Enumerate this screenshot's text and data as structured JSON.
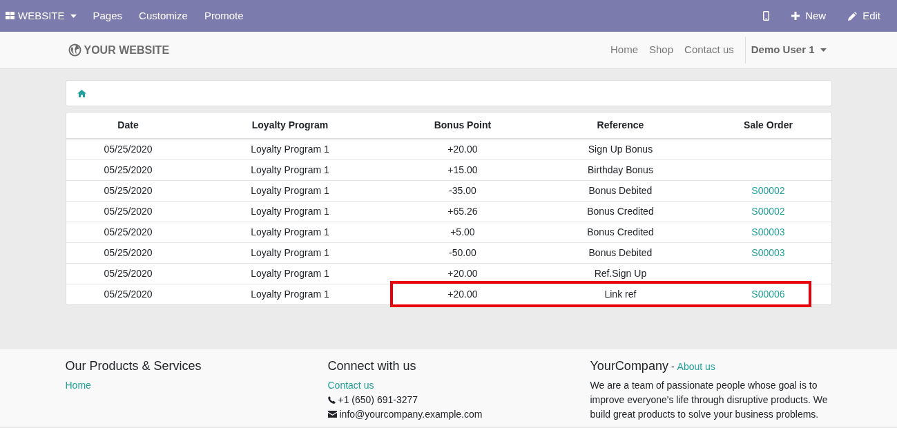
{
  "topbar": {
    "menu": "WEBSITE",
    "items": [
      "Pages",
      "Customize",
      "Promote"
    ],
    "actions": [
      {
        "kind": "mobile"
      },
      {
        "kind": "new",
        "label": "New"
      },
      {
        "kind": "edit",
        "label": "Edit"
      }
    ]
  },
  "header": {
    "logo": "YOUR WEBSITE",
    "nav": [
      {
        "label": "Home"
      },
      {
        "label": "Shop"
      },
      {
        "label": "Contact us"
      }
    ],
    "user": "Demo User 1"
  },
  "table": {
    "columns": [
      "Date",
      "Loyalty Program",
      "Bonus Point",
      "Reference",
      "Sale Order"
    ],
    "rows": [
      {
        "cells": [
          "05/25/2020",
          "Loyalty Program 1",
          "+20.00",
          "Sign Up Bonus",
          ""
        ],
        "highlighted": false
      },
      {
        "cells": [
          "05/25/2020",
          "Loyalty Program 1",
          "+15.00",
          "Birthday Bonus",
          ""
        ],
        "highlighted": false
      },
      {
        "cells": [
          "05/25/2020",
          "Loyalty Program 1",
          "-35.00",
          "Bonus Debited",
          "S00002"
        ],
        "highlighted": false
      },
      {
        "cells": [
          "05/25/2020",
          "Loyalty Program 1",
          "+65.26",
          "Bonus Credited",
          "S00002"
        ],
        "highlighted": false
      },
      {
        "cells": [
          "05/25/2020",
          "Loyalty Program 1",
          "+5.00",
          "Bonus Credited",
          "S00003"
        ],
        "highlighted": false
      },
      {
        "cells": [
          "05/25/2020",
          "Loyalty Program 1",
          "-50.00",
          "Bonus Debited",
          "S00003"
        ],
        "highlighted": false
      },
      {
        "cells": [
          "05/25/2020",
          "Loyalty Program 1",
          "+20.00",
          "Ref.Sign Up",
          ""
        ],
        "highlighted": false
      },
      {
        "cells": [
          "05/25/2020",
          "Loyalty Program 1",
          "+20.00",
          "Link ref",
          "S00006"
        ],
        "highlighted": true
      }
    ]
  },
  "footer": {
    "col1": {
      "title": "Our Products & Services",
      "links": [
        "Home"
      ]
    },
    "col2": {
      "title": "Connect with us",
      "link": "Contact us",
      "phone": "+1 (650) 691-3277",
      "email": "info@yourcompany.example.com"
    },
    "col3": {
      "title": "YourCompany",
      "separator": "-",
      "link": "About us",
      "text": "We are a team of passionate people whose goal is to improve everyone's life through disruptive products. We build great products to solve your business problems."
    }
  }
}
